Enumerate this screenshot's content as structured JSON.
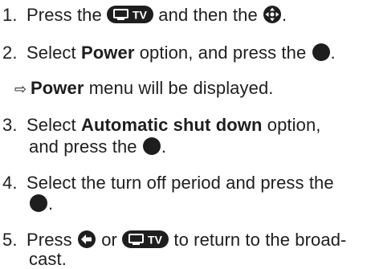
{
  "steps": [
    {
      "number": "1.",
      "parts": [
        "Press the",
        "and then the",
        "."
      ]
    },
    {
      "number": "2.",
      "pre": "Select",
      "bold": "Power",
      "post": "option, and press the",
      "end": "."
    },
    {
      "result_arrow": "⇨",
      "bold": "Power",
      "post": "menu will be displayed."
    },
    {
      "number": "3.",
      "pre": "Select",
      "bold": "Automatic shut down",
      "post": "option,",
      "line2_pre": "and press the",
      "line2_end": "."
    },
    {
      "number": "4.",
      "text": "Select the turn off period and press the",
      "line2_end": "."
    },
    {
      "number": "5.",
      "pre": "Press",
      "mid": "or",
      "post": "to return to the broad-",
      "line2": "cast."
    }
  ],
  "icons": {
    "tv_button": "tv-button-icon",
    "nav_button": "navigation-dpad-icon",
    "ok_button": "ok-button-icon",
    "back_button": "back-button-icon",
    "tv_label": "TV",
    "color": "#1e1e1e"
  }
}
